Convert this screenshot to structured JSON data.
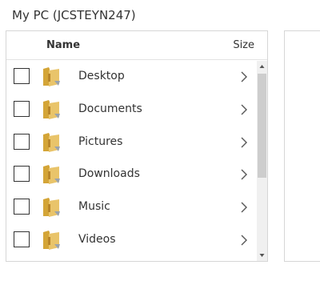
{
  "title": "My PC (JCSTEYN247)",
  "columns": {
    "name": "Name",
    "size": "Size"
  },
  "items": [
    {
      "label": "Desktop",
      "icon": "folder-icon",
      "checked": false
    },
    {
      "label": "Documents",
      "icon": "folder-icon",
      "checked": false
    },
    {
      "label": "Pictures",
      "icon": "folder-icon",
      "checked": false
    },
    {
      "label": "Downloads",
      "icon": "folder-icon",
      "checked": false
    },
    {
      "label": "Music",
      "icon": "folder-icon",
      "checked": false
    },
    {
      "label": "Videos",
      "icon": "folder-icon",
      "checked": false
    }
  ],
  "colors": {
    "folder": "#e9c46a",
    "folder_dark": "#d4a537",
    "border": "#d6d6d6",
    "scroll_thumb": "#cdcdcd"
  }
}
